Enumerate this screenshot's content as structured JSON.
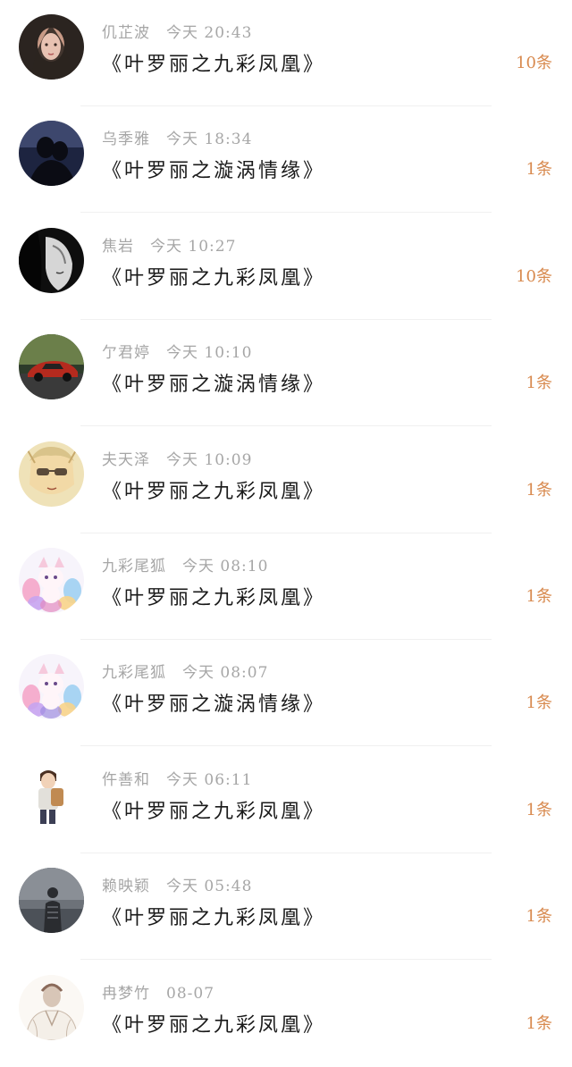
{
  "items": [
    {
      "name": "仉芷波",
      "time": "今天 20:43",
      "title": "《叶罗丽之九彩凤凰》",
      "count": "10条",
      "avatar_icon": "girl-portrait-icon",
      "avatar_colors": [
        "#2b2420",
        "#c89a86"
      ]
    },
    {
      "name": "乌季雅",
      "time": "今天 18:34",
      "title": "《叶罗丽之漩涡情缘》",
      "count": "1条",
      "avatar_icon": "dark-couple-icon",
      "avatar_colors": [
        "#1d2440",
        "#5d6a9a"
      ]
    },
    {
      "name": "焦岩",
      "time": "今天 10:27",
      "title": "《叶罗丽之九彩凤凰》",
      "count": "10条",
      "avatar_icon": "bw-girl-icon",
      "avatar_colors": [
        "#0e0e0e",
        "#d6d6d6"
      ]
    },
    {
      "name": "亇君婷",
      "time": "今天 10:10",
      "title": "《叶罗丽之漩涡情缘》",
      "count": "1条",
      "avatar_icon": "red-car-icon",
      "avatar_colors": [
        "#2d3b2a",
        "#b52a1e"
      ]
    },
    {
      "name": "夫天泽",
      "time": "今天 10:09",
      "title": "《叶罗丽之九彩凤凰》",
      "count": "1条",
      "avatar_icon": "anime-sunglasses-icon",
      "avatar_colors": [
        "#efe2b8",
        "#5a4a3a"
      ]
    },
    {
      "name": "九彩尾狐",
      "time": "今天 08:10",
      "title": "《叶罗丽之九彩凤凰》",
      "count": "1条",
      "avatar_icon": "nine-tail-fox-icon",
      "avatar_colors": [
        "#f7f4fb",
        "#e38ac0"
      ]
    },
    {
      "name": "九彩尾狐",
      "time": "今天 08:07",
      "title": "《叶罗丽之漩涡情缘》",
      "count": "1条",
      "avatar_icon": "nine-tail-fox-icon",
      "avatar_colors": [
        "#f7f4fb",
        "#9e8de0"
      ]
    },
    {
      "name": "仵善和",
      "time": "今天 06:11",
      "title": "《叶罗丽之九彩凤凰》",
      "count": "1条",
      "avatar_icon": "boy-backpack-icon",
      "avatar_colors": [
        "#ffffff",
        "#c08a52"
      ]
    },
    {
      "name": "赖映颖",
      "time": "今天 05:48",
      "title": "《叶罗丽之九彩凤凰》",
      "count": "1条",
      "avatar_icon": "foggy-person-icon",
      "avatar_colors": [
        "#4c5158",
        "#8a8f96"
      ]
    },
    {
      "name": "冉梦竹",
      "time": "08-07",
      "title": "《叶罗丽之九彩凤凰》",
      "count": "1条",
      "avatar_icon": "sketch-boy-icon",
      "avatar_colors": [
        "#fbf8f4",
        "#d0b9a8"
      ]
    }
  ],
  "colors": {
    "name_time": "#a6a6a6",
    "title": "#1a1a1a",
    "count": "#d88a4f",
    "divider": "#f0f0f0"
  }
}
